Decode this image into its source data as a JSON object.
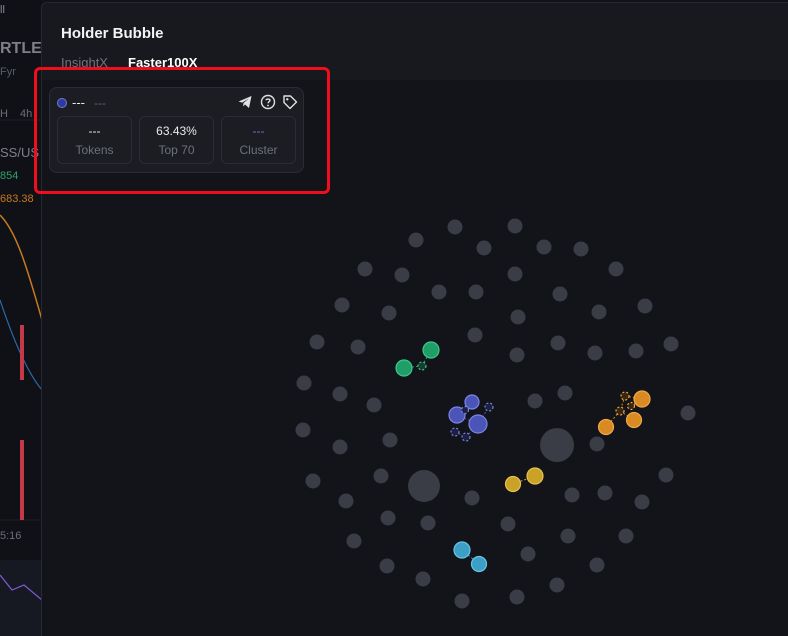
{
  "background_chart": {
    "labels": [
      "ll",
      "RTLE",
      "Fyr",
      "H",
      "4h",
      "SS/US",
      "854",
      "683.38",
      "5:16"
    ]
  },
  "panel": {
    "title": "Holder Bubble",
    "tabs": [
      {
        "label": "InsightX",
        "active": false
      },
      {
        "label": "Faster100X",
        "active": true
      }
    ]
  },
  "info_card": {
    "name": "---",
    "sub": "---",
    "icons": [
      "telegram-icon",
      "help-icon",
      "tag-icon"
    ],
    "stats": [
      {
        "value": "---",
        "label": "Tokens"
      },
      {
        "value": "63.43%",
        "label": "Top 70"
      },
      {
        "value": "---",
        "label": "Cluster"
      }
    ]
  },
  "colors": {
    "highlight": "#f00d1d",
    "bubble_default": "#3a3d45",
    "cluster_green": "#1f9e68",
    "cluster_blue": "#4b55b8",
    "cluster_orange": "#d98a22",
    "cluster_yellow": "#c9a227",
    "cluster_cyan": "#3b9fc6",
    "cluster_purple": "#7b69e0"
  },
  "bubbles": {
    "count_grey": 76,
    "clusters": [
      "green",
      "blue",
      "orange",
      "yellow",
      "cyan"
    ]
  }
}
